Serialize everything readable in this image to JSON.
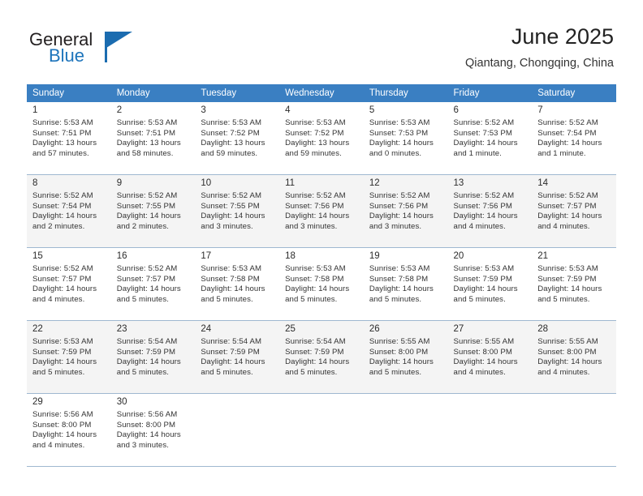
{
  "logo": {
    "word_one": "General",
    "word_two": "Blue",
    "triangle_icon": "blue-triangle-icon"
  },
  "header": {
    "title": "June 2025",
    "subtitle": "Qiantang, Chongqing, China"
  },
  "colors": {
    "header_row": "#3a7fc2",
    "logo_blue": "#1d74bb",
    "row_shade": "#f4f4f4",
    "cell_border": "#9fb8d0"
  },
  "weekdays": [
    "Sunday",
    "Monday",
    "Tuesday",
    "Wednesday",
    "Thursday",
    "Friday",
    "Saturday"
  ],
  "weeks": [
    {
      "shaded": false,
      "days": [
        {
          "day": "1",
          "sunrise": "Sunrise: 5:53 AM",
          "sunset": "Sunset: 7:51 PM",
          "daylight": "Daylight: 13 hours and 57 minutes."
        },
        {
          "day": "2",
          "sunrise": "Sunrise: 5:53 AM",
          "sunset": "Sunset: 7:51 PM",
          "daylight": "Daylight: 13 hours and 58 minutes."
        },
        {
          "day": "3",
          "sunrise": "Sunrise: 5:53 AM",
          "sunset": "Sunset: 7:52 PM",
          "daylight": "Daylight: 13 hours and 59 minutes."
        },
        {
          "day": "4",
          "sunrise": "Sunrise: 5:53 AM",
          "sunset": "Sunset: 7:52 PM",
          "daylight": "Daylight: 13 hours and 59 minutes."
        },
        {
          "day": "5",
          "sunrise": "Sunrise: 5:53 AM",
          "sunset": "Sunset: 7:53 PM",
          "daylight": "Daylight: 14 hours and 0 minutes."
        },
        {
          "day": "6",
          "sunrise": "Sunrise: 5:52 AM",
          "sunset": "Sunset: 7:53 PM",
          "daylight": "Daylight: 14 hours and 1 minute."
        },
        {
          "day": "7",
          "sunrise": "Sunrise: 5:52 AM",
          "sunset": "Sunset: 7:54 PM",
          "daylight": "Daylight: 14 hours and 1 minute."
        }
      ]
    },
    {
      "shaded": true,
      "days": [
        {
          "day": "8",
          "sunrise": "Sunrise: 5:52 AM",
          "sunset": "Sunset: 7:54 PM",
          "daylight": "Daylight: 14 hours and 2 minutes."
        },
        {
          "day": "9",
          "sunrise": "Sunrise: 5:52 AM",
          "sunset": "Sunset: 7:55 PM",
          "daylight": "Daylight: 14 hours and 2 minutes."
        },
        {
          "day": "10",
          "sunrise": "Sunrise: 5:52 AM",
          "sunset": "Sunset: 7:55 PM",
          "daylight": "Daylight: 14 hours and 3 minutes."
        },
        {
          "day": "11",
          "sunrise": "Sunrise: 5:52 AM",
          "sunset": "Sunset: 7:56 PM",
          "daylight": "Daylight: 14 hours and 3 minutes."
        },
        {
          "day": "12",
          "sunrise": "Sunrise: 5:52 AM",
          "sunset": "Sunset: 7:56 PM",
          "daylight": "Daylight: 14 hours and 3 minutes."
        },
        {
          "day": "13",
          "sunrise": "Sunrise: 5:52 AM",
          "sunset": "Sunset: 7:56 PM",
          "daylight": "Daylight: 14 hours and 4 minutes."
        },
        {
          "day": "14",
          "sunrise": "Sunrise: 5:52 AM",
          "sunset": "Sunset: 7:57 PM",
          "daylight": "Daylight: 14 hours and 4 minutes."
        }
      ]
    },
    {
      "shaded": false,
      "days": [
        {
          "day": "15",
          "sunrise": "Sunrise: 5:52 AM",
          "sunset": "Sunset: 7:57 PM",
          "daylight": "Daylight: 14 hours and 4 minutes."
        },
        {
          "day": "16",
          "sunrise": "Sunrise: 5:52 AM",
          "sunset": "Sunset: 7:57 PM",
          "daylight": "Daylight: 14 hours and 5 minutes."
        },
        {
          "day": "17",
          "sunrise": "Sunrise: 5:53 AM",
          "sunset": "Sunset: 7:58 PM",
          "daylight": "Daylight: 14 hours and 5 minutes."
        },
        {
          "day": "18",
          "sunrise": "Sunrise: 5:53 AM",
          "sunset": "Sunset: 7:58 PM",
          "daylight": "Daylight: 14 hours and 5 minutes."
        },
        {
          "day": "19",
          "sunrise": "Sunrise: 5:53 AM",
          "sunset": "Sunset: 7:58 PM",
          "daylight": "Daylight: 14 hours and 5 minutes."
        },
        {
          "day": "20",
          "sunrise": "Sunrise: 5:53 AM",
          "sunset": "Sunset: 7:59 PM",
          "daylight": "Daylight: 14 hours and 5 minutes."
        },
        {
          "day": "21",
          "sunrise": "Sunrise: 5:53 AM",
          "sunset": "Sunset: 7:59 PM",
          "daylight": "Daylight: 14 hours and 5 minutes."
        }
      ]
    },
    {
      "shaded": true,
      "days": [
        {
          "day": "22",
          "sunrise": "Sunrise: 5:53 AM",
          "sunset": "Sunset: 7:59 PM",
          "daylight": "Daylight: 14 hours and 5 minutes."
        },
        {
          "day": "23",
          "sunrise": "Sunrise: 5:54 AM",
          "sunset": "Sunset: 7:59 PM",
          "daylight": "Daylight: 14 hours and 5 minutes."
        },
        {
          "day": "24",
          "sunrise": "Sunrise: 5:54 AM",
          "sunset": "Sunset: 7:59 PM",
          "daylight": "Daylight: 14 hours and 5 minutes."
        },
        {
          "day": "25",
          "sunrise": "Sunrise: 5:54 AM",
          "sunset": "Sunset: 7:59 PM",
          "daylight": "Daylight: 14 hours and 5 minutes."
        },
        {
          "day": "26",
          "sunrise": "Sunrise: 5:55 AM",
          "sunset": "Sunset: 8:00 PM",
          "daylight": "Daylight: 14 hours and 5 minutes."
        },
        {
          "day": "27",
          "sunrise": "Sunrise: 5:55 AM",
          "sunset": "Sunset: 8:00 PM",
          "daylight": "Daylight: 14 hours and 4 minutes."
        },
        {
          "day": "28",
          "sunrise": "Sunrise: 5:55 AM",
          "sunset": "Sunset: 8:00 PM",
          "daylight": "Daylight: 14 hours and 4 minutes."
        }
      ]
    },
    {
      "shaded": false,
      "days": [
        {
          "day": "29",
          "sunrise": "Sunrise: 5:56 AM",
          "sunset": "Sunset: 8:00 PM",
          "daylight": "Daylight: 14 hours and 4 minutes."
        },
        {
          "day": "30",
          "sunrise": "Sunrise: 5:56 AM",
          "sunset": "Sunset: 8:00 PM",
          "daylight": "Daylight: 14 hours and 3 minutes."
        },
        null,
        null,
        null,
        null,
        null
      ]
    }
  ]
}
